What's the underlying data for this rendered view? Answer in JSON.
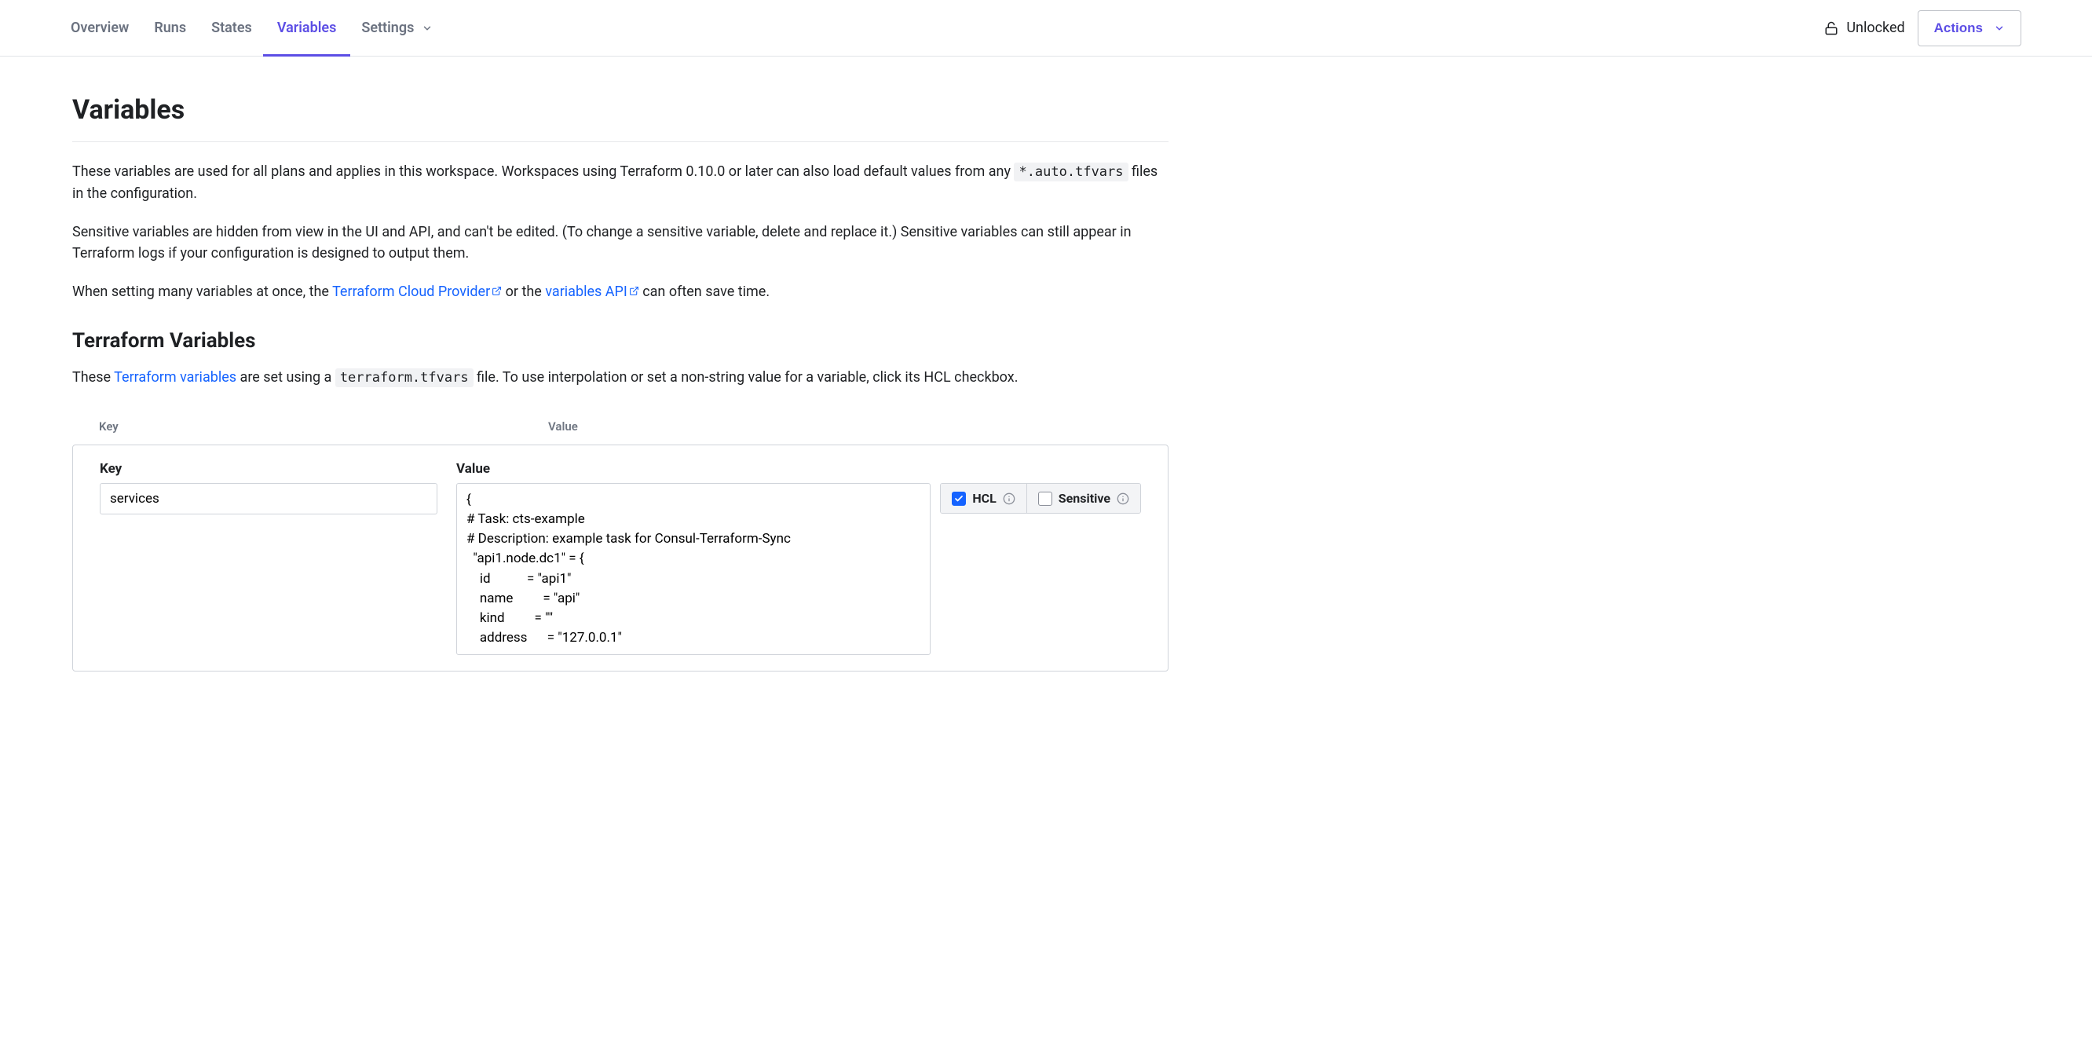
{
  "tabs": {
    "overview": "Overview",
    "runs": "Runs",
    "states": "States",
    "variables": "Variables",
    "settings": "Settings"
  },
  "status": {
    "unlocked": "Unlocked"
  },
  "actions_button": "Actions",
  "page_title": "Variables",
  "descriptions": {
    "para1_before": "These variables are used for all plans and applies in this workspace. Workspaces using Terraform 0.10.0 or later can also load default values from any ",
    "para1_code": "*.auto.tfvars",
    "para1_after": " files in the configuration.",
    "para2": "Sensitive variables are hidden from view in the UI and API, and can't be edited. (To change a sensitive variable, delete and replace it.) Sensitive variables can still appear in Terraform logs if your configuration is designed to output them.",
    "para3_before": "When setting many variables at once, the ",
    "para3_link1": "Terraform Cloud Provider",
    "para3_mid": " or the ",
    "para3_link2": "variables API",
    "para3_after": " can often save time."
  },
  "section_title": "Terraform Variables",
  "section_desc": {
    "before": "These ",
    "link": "Terraform variables",
    "mid": " are set using a ",
    "code": "terraform.tfvars",
    "after": " file. To use interpolation or set a non-string value for a variable, click its HCL checkbox."
  },
  "table": {
    "header_key": "Key",
    "header_value": "Value"
  },
  "editor": {
    "key_label": "Key",
    "value_label": "Value",
    "key_value": "services",
    "value_content": "{\n# Task: cts-example\n# Description: example task for Consul-Terraform-Sync\n  \"api1.node.dc1\" = {\n    id           = \"api1\"\n    name         = \"api\"\n    kind         = \"\"\n    address      = \"127.0.0.1\"",
    "hcl_label": "HCL",
    "sensitive_label": "Sensitive",
    "hcl_checked": true,
    "sensitive_checked": false
  }
}
